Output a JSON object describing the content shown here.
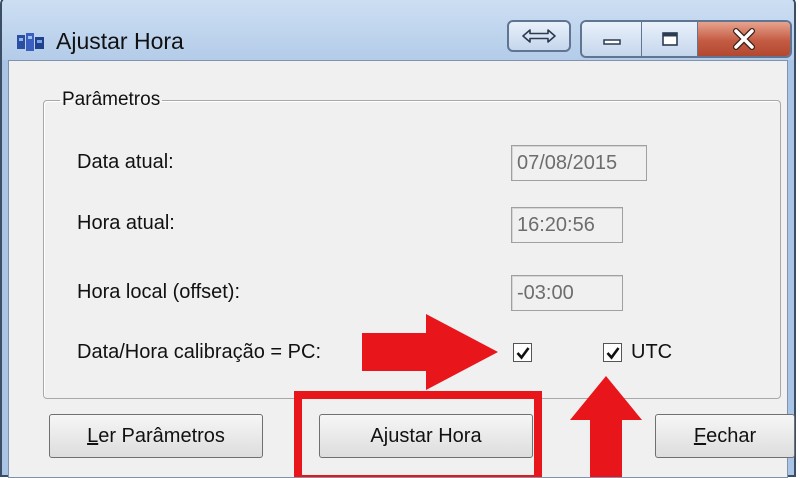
{
  "window": {
    "title": "Ajustar Hora"
  },
  "group": {
    "legend": "Parâmetros"
  },
  "fields": {
    "data_atual": {
      "label": "Data atual:",
      "value": "07/08/2015"
    },
    "hora_atual": {
      "label": "Hora atual:",
      "value": "16:20:56"
    },
    "hora_local": {
      "label": "Hora local (offset):",
      "value": "-03:00"
    }
  },
  "calibration": {
    "label": "Data/Hora calibração = PC:",
    "pc_checked": true,
    "utc_label": "UTC",
    "utc_checked": true
  },
  "buttons": {
    "ler_first": "L",
    "ler_rest": "er Parâmetros",
    "ajustar": "Ajustar Hora",
    "fechar_first": "F",
    "fechar_rest": "echar"
  },
  "colors": {
    "annotation_red": "#e8151b",
    "title_bar": "#b9d1ea",
    "close_button": "#c45b43"
  },
  "icons": [
    "app-icon",
    "snap-icon",
    "minimize-icon",
    "maximize-icon",
    "close-icon",
    "checkmark-icon",
    "arrow-right-annotation",
    "arrow-up-annotation"
  ]
}
